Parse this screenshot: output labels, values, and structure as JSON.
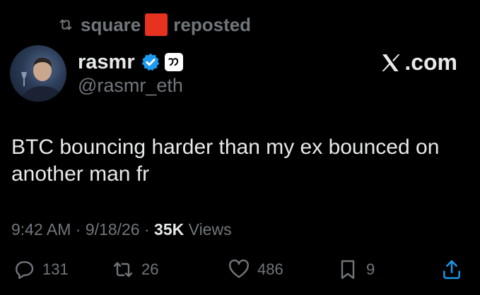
{
  "repost_bar": {
    "user": "square",
    "label": "reposted",
    "emoji_color": "#e6321e"
  },
  "author": {
    "display_name": "rasmr",
    "handle": "@rasmr_eth",
    "verified_color": "#1d9bf0"
  },
  "site_mark": {
    "label": ".com"
  },
  "tweet": {
    "text": "BTC bouncing harder than my ex bounced on another man fr"
  },
  "meta": {
    "time": "9:42 AM",
    "separator": "·",
    "date": "9/18/26",
    "views_count": "35K",
    "views_label": "Views"
  },
  "actions": {
    "replies": "131",
    "reposts": "26",
    "likes": "486",
    "bookmarks": "9"
  },
  "icons": {
    "repost": "repost-icon",
    "verified": "verified-badge-icon",
    "affiliate": "affiliate-badge-icon",
    "x_logo": "x-logo-icon",
    "reply": "reply-icon",
    "like": "heart-icon",
    "bookmark": "bookmark-icon",
    "share": "share-icon"
  }
}
